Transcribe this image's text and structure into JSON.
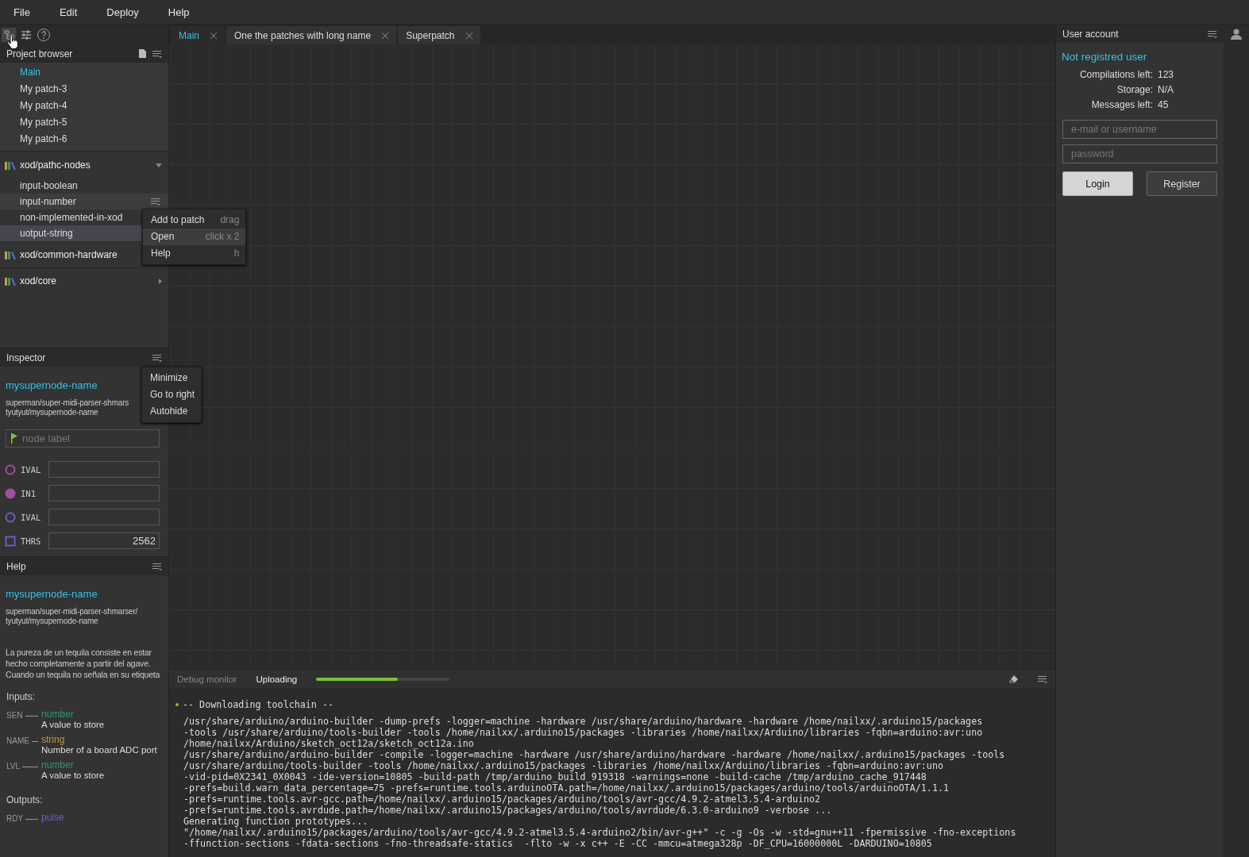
{
  "menu": [
    {
      "label": "File"
    },
    {
      "label": "Edit"
    },
    {
      "label": "Deploy"
    },
    {
      "label": "Help"
    }
  ],
  "project_browser": {
    "title": "Project browser",
    "patches": [
      {
        "label": "Main",
        "selected": true
      },
      {
        "label": "My patch-3",
        "selected": false
      },
      {
        "label": "My patch-4",
        "selected": false
      },
      {
        "label": "My patch-5",
        "selected": false
      },
      {
        "label": "My patch-6",
        "selected": false
      }
    ],
    "libraries": [
      {
        "name": "xod/pathc-nodes",
        "expanded": true,
        "nodes": [
          {
            "label": "input-boolean",
            "hovered": false,
            "selected": false
          },
          {
            "label": "input-number",
            "hovered": true,
            "selected": false
          },
          {
            "label": "non-implemented-in-xod",
            "hovered": false,
            "selected": false
          },
          {
            "label": "uotput-string",
            "hovered": false,
            "selected": true
          }
        ]
      },
      {
        "name": "xod/common-hardware",
        "expanded": false
      },
      {
        "name": "xod/core",
        "expanded": false
      }
    ]
  },
  "node_menu": [
    {
      "label": "Add to patch",
      "shortcut": "drag",
      "highlighted": false
    },
    {
      "label": "Open",
      "shortcut": "click x 2",
      "highlighted": true
    },
    {
      "label": "Help",
      "shortcut": "h",
      "highlighted": false
    }
  ],
  "inspector": {
    "title": "Inspector",
    "node_name": "mysupernode-name",
    "path": "superman/super-midi-parser-shmars\ntyutyut/mysupernode-name",
    "label_field": {
      "placeholder": "node label"
    },
    "pins": [
      {
        "kind": "circle",
        "name": "IVAL",
        "filled": false,
        "color": "#a0509f"
      },
      {
        "kind": "circle",
        "name": "IN1",
        "filled": true,
        "color": "#a0509f"
      },
      {
        "kind": "circle",
        "name": "IVAL",
        "filled": false,
        "color": "#6a5fc0"
      },
      {
        "kind": "square",
        "name": "THRS",
        "filled": false,
        "color": "#6a5fc0",
        "value": "2562"
      }
    ]
  },
  "panel_menu": [
    {
      "label": "Minimize"
    },
    {
      "label": "Go to right"
    },
    {
      "label": "Autohide"
    }
  ],
  "help": {
    "title": "Help",
    "node_name": "mysupernode-name",
    "path": "superman/super-midi-parser-shmarser/\ntyutyut/mysupernode-name",
    "description": "La pureza de un tequila consiste en estar hecho completamente a partir del agave. Cuando un tequila no señala en su etiqueta",
    "inputs_heading": "Inputs:",
    "inputs": [
      {
        "pin": "SEN",
        "type": "number",
        "color": "#2e9670",
        "description": "A value to store"
      },
      {
        "pin": "NAME",
        "type": "string",
        "color": "#c49a36",
        "description": "Number of a board ADC port"
      },
      {
        "pin": "LVL",
        "type": "number",
        "color": "#2e9670",
        "description": "A value to store"
      }
    ],
    "outputs_heading": "Outputs:",
    "outputs": [
      {
        "pin": "RDY",
        "type": "pulse",
        "color": "#6a5fc8"
      }
    ]
  },
  "tabs": [
    {
      "label": "Main",
      "selected": true
    },
    {
      "label": "One the patches with long name",
      "selected": false
    },
    {
      "label": "Superpatch",
      "selected": false
    }
  ],
  "debug": {
    "tabs": [
      {
        "label": "Debug monitor",
        "selected": false
      },
      {
        "label": "Uploading",
        "selected": true
      }
    ],
    "progress": {
      "level": 0.61
    },
    "log": [
      {
        "kind": "heading",
        "text": "-- Downloading toolchain --"
      },
      {
        "kind": "line",
        "text": "/usr/share/arduino/arduino-builder -dump-prefs -logger=machine -hardware /usr/share/arduino/hardware -hardware /home/nailxx/.arduino15/packages"
      },
      {
        "kind": "line",
        "text": "-tools /usr/share/arduino/tools-builder -tools /home/nailxx/.arduino15/packages -libraries /home/nailxx/Arduino/libraries -fqbn=arduino:avr:uno"
      },
      {
        "kind": "line",
        "text": "/home/nailxx/Arduino/sketch_oct12a/sketch_oct12a.ino"
      },
      {
        "kind": "line",
        "text": "/usr/share/arduino/arduino-builder -compile -logger=machine -hardware /usr/share/arduino/hardware -hardware /home/nailxx/.arduino15/packages -tools"
      },
      {
        "kind": "line",
        "text": "/usr/share/arduino/tools-builder -tools /home/nailxx/.arduino15/packages -libraries /home/nailxx/Arduino/libraries -fqbn=arduino:avr:uno"
      },
      {
        "kind": "line",
        "text": "-vid-pid=0X2341_0X0043 -ide-version=10805 -build-path /tmp/arduino_build_919318 -warnings=none -build-cache /tmp/arduino_cache_917448"
      },
      {
        "kind": "line",
        "text": "-prefs=build.warn_data_percentage=75 -prefs=runtime.tools.arduinoOTA.path=/home/nailxx/.arduino15/packages/arduino/tools/arduinoOTA/1.1.1"
      },
      {
        "kind": "line",
        "text": "-prefs=runtime.tools.avr-gcc.path=/home/nailxx/.arduino15/packages/arduino/tools/avr-gcc/4.9.2-atmel3.5.4-arduino2"
      },
      {
        "kind": "line",
        "text": "-prefs=runtime.tools.avrdude.path=/home/nailxx/.arduino15/packages/arduino/tools/avrdude/6.3.0-arduino9 -verbose ..."
      },
      {
        "kind": "line",
        "text": "Generating function prototypes..."
      },
      {
        "kind": "line",
        "text": "\"/home/nailxx/.arduino15/packages/arduino/tools/avr-gcc/4.9.2-atmel3.5.4-arduino2/bin/avr-g++\" -c -g -Os -w -std=gnu++11 -fpermissive -fno-exceptions"
      },
      {
        "kind": "line",
        "text": "-ffunction-sections -fdata-sections -fno-threadsafe-statics  -flto -w -x c++ -E -CC -mmcu=atmega328p -DF_CPU=16000000L -DARDUINO=10805"
      }
    ]
  },
  "account": {
    "title": "User account",
    "status": "Not registred user",
    "stats": [
      {
        "label": "Compilations left:",
        "value": "123"
      },
      {
        "label": "Storage:",
        "value": "N/A"
      },
      {
        "label": "Messages left:",
        "value": "45"
      }
    ],
    "fields": [
      {
        "placeholder": "e-mail or username"
      },
      {
        "placeholder": "password"
      }
    ],
    "buttons": [
      {
        "label": "Login",
        "kind": "primary"
      },
      {
        "label": "Register",
        "kind": "secondary"
      }
    ]
  }
}
